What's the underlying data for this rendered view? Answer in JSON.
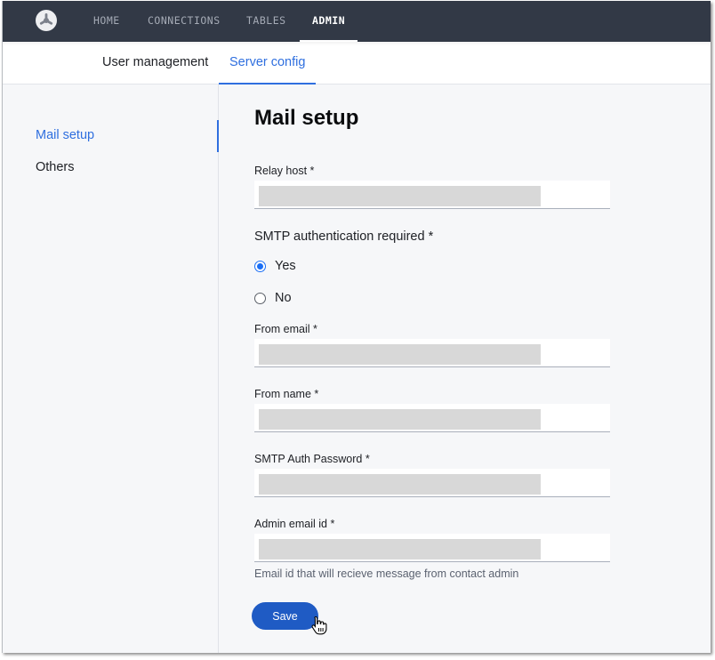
{
  "topnav": {
    "logo": "app-logo-icon",
    "items": [
      {
        "label": "HOME",
        "active": false
      },
      {
        "label": "CONNECTIONS",
        "active": false
      },
      {
        "label": "TABLES",
        "active": false
      },
      {
        "label": "ADMIN",
        "active": true
      }
    ]
  },
  "subnav": {
    "tabs": [
      {
        "label": "User management",
        "active": false
      },
      {
        "label": "Server config",
        "active": true
      }
    ]
  },
  "sidebar": {
    "items": [
      {
        "label": "Mail setup",
        "active": true
      },
      {
        "label": "Others",
        "active": false
      }
    ]
  },
  "main": {
    "title": "Mail setup",
    "fields": {
      "relay_host": {
        "label": "Relay host *",
        "value": ""
      },
      "smtp_auth": {
        "label": "SMTP authentication required *",
        "options": [
          {
            "label": "Yes",
            "checked": true
          },
          {
            "label": "No",
            "checked": false
          }
        ]
      },
      "from_email": {
        "label": "From email *",
        "value": ""
      },
      "from_name": {
        "label": "From name *",
        "value": ""
      },
      "smtp_password": {
        "label": "SMTP Auth Password *",
        "value": ""
      },
      "admin_email": {
        "label": "Admin email id *",
        "value": "",
        "helper": "Email id that will recieve message from contact admin"
      }
    },
    "save_label": "Save"
  },
  "colors": {
    "accent": "#2f6fdf",
    "topbar": "#323946",
    "button": "#1f5bc4",
    "radio_checked": "#1a6ef5"
  }
}
